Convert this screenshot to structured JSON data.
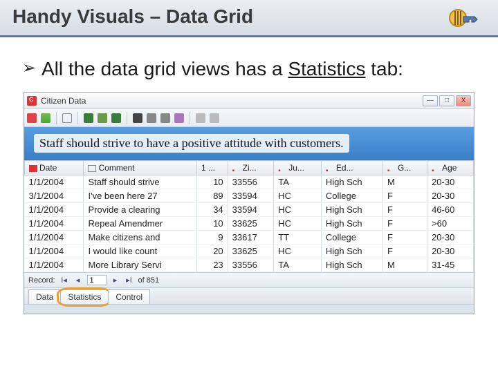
{
  "slide": {
    "title": "Handy Visuals – Data Grid",
    "bullet_prefix": "All the data grid views has a ",
    "bullet_underlined": "Statistics",
    "bullet_suffix": " tab:"
  },
  "window": {
    "title": "Citizen Data",
    "min": "—",
    "max": "□",
    "close": "X"
  },
  "banner": {
    "text": "Staff should strive to have a positive attitude with customers."
  },
  "columns": [
    "Date",
    "Comment",
    "1 ...",
    "Zi...",
    "Ju...",
    "Ed...",
    "G...",
    "Age"
  ],
  "rows": [
    {
      "date": "1/1/2004",
      "comment": "Staff should strive",
      "c1": "10",
      "zi": "33556",
      "ju": "TA",
      "ed": "High Sch",
      "g": "M",
      "age": "20-30"
    },
    {
      "date": "3/1/2004",
      "comment": "I've been here 27",
      "c1": "89",
      "zi": "33594",
      "ju": "HC",
      "ed": "College",
      "g": "F",
      "age": "20-30"
    },
    {
      "date": "1/1/2004",
      "comment": "Provide a clearing",
      "c1": "34",
      "zi": "33594",
      "ju": "HC",
      "ed": "High Sch",
      "g": "F",
      "age": "46-60"
    },
    {
      "date": "1/1/2004",
      "comment": "Repeal Amendmer",
      "c1": "10",
      "zi": "33625",
      "ju": "HC",
      "ed": "High Sch",
      "g": "F",
      "age": ">60"
    },
    {
      "date": "1/1/2004",
      "comment": "Make citizens and",
      "c1": "9",
      "zi": "33617",
      "ju": "TT",
      "ed": "College",
      "g": "F",
      "age": "20-30"
    },
    {
      "date": "1/1/2004",
      "comment": "I would like count",
      "c1": "20",
      "zi": "33625",
      "ju": "HC",
      "ed": "High Sch",
      "g": "F",
      "age": "20-30"
    },
    {
      "date": "1/1/2004",
      "comment": "More Library Servi",
      "c1": "23",
      "zi": "33556",
      "ju": "TA",
      "ed": "High Sch",
      "g": "M",
      "age": "31-45"
    }
  ],
  "nav": {
    "label": "Record:",
    "value": "1",
    "total": "of 851"
  },
  "tabs": {
    "t1": "Data",
    "t2": "Statistics",
    "t3": "Control"
  }
}
